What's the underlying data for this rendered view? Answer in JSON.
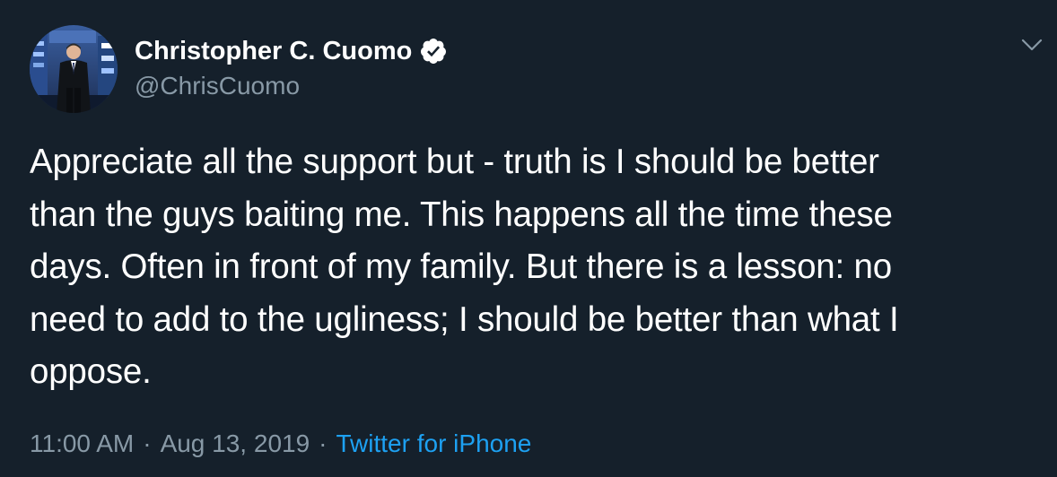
{
  "author": {
    "display_name": "Christopher C. Cuomo",
    "handle": "@ChrisCuomo",
    "verified": true,
    "avatar_icon": "profile-photo"
  },
  "tweet": {
    "text": "Appreciate all the support but - truth is I should be better\nthan the guys baiting me. This happens all the time these\ndays. Often in front of my family. But there is a lesson: no\nneed to add to the ugliness; I should be better than what I\noppose.",
    "time": "11:00 AM",
    "date": "Aug 13, 2019",
    "separator": "·",
    "source": "Twitter for iPhone"
  },
  "menu": {
    "icon": "chevron-down-icon"
  },
  "colors": {
    "background": "#15202b",
    "text_primary": "#ffffff",
    "text_secondary": "#8899a6",
    "accent": "#1da1f2"
  }
}
